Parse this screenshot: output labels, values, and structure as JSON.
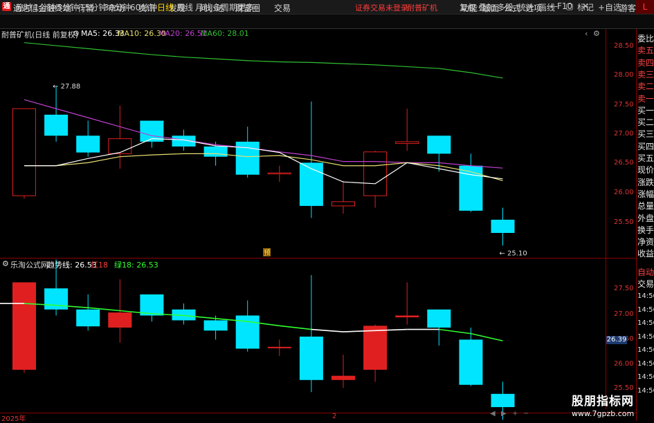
{
  "titlebar": {
    "app_title": "通达信金融终端",
    "menus": [
      "行情",
      "市场",
      "资讯",
      "发现",
      "问小达",
      "财富圈",
      "交易"
    ],
    "notice": "证券交易未登录",
    "stock_name": "耐普矿机",
    "right_menus": [
      "功能",
      "版面",
      "公式",
      "选项"
    ],
    "guest": "游客"
  },
  "toolbar": {
    "periods": [
      "分时",
      "1分钟",
      "5分钟",
      "15分钟",
      "30分钟",
      "60分钟",
      "日线",
      "周线",
      "月线",
      "多周期",
      "更多"
    ],
    "active": "日线",
    "right_tools": [
      "复权",
      "叠加",
      "多股",
      "统计",
      "画线",
      "F10",
      "标记",
      "+自选"
    ],
    "right_tab": "L"
  },
  "main_info": {
    "title": "耐普矿机(日线 前复权)",
    "ma5": "MA5: 26.33",
    "ma10": "MA10: 26.30",
    "ma20": "MA20: 26.51",
    "ma60": "MA60: 28.01",
    "high_mark": "27.88",
    "low_mark": "25.10",
    "flag": "预"
  },
  "sub_info": {
    "title": "乐淘公式网",
    "trend": "趋势线: 26.53",
    "red": "红18",
    "green": "绿18: 26.53",
    "cross_value": "26.39"
  },
  "axis_main": [
    "28.50",
    "28.00",
    "27.50",
    "27.00",
    "26.50",
    "26.00",
    "25.50"
  ],
  "axis_sub": [
    "27.50",
    "27.00",
    "26.50",
    "26.00",
    "25.50"
  ],
  "time_axis": {
    "start": "2025年",
    "mid": "2"
  },
  "right_panel": {
    "labels": [
      "委比",
      "卖五",
      "卖四",
      "卖三",
      "卖二",
      "卖一",
      "买一",
      "买二",
      "买三",
      "买四",
      "买五",
      "现价",
      "涨跌",
      "涨幅",
      "总量",
      "外盘",
      "换手",
      "净资",
      "收益"
    ],
    "mode1": "自动",
    "mode2": "交易",
    "times": [
      "14:56",
      "14:56",
      "14:56",
      "14:56",
      "14:56",
      "14:56",
      "14:56",
      "14:56"
    ]
  },
  "watermark": {
    "line1": "股朋指标网",
    "line2": "www.7gpzb.com"
  },
  "colors": {
    "up": "#e02020",
    "down": "#00e5ff",
    "ma5": "#ffffff",
    "ma10": "#e8e070",
    "ma20": "#c040d0",
    "ma60": "#30c030",
    "trend": "#30ff30"
  },
  "chart_data": [
    {
      "type": "candlestick",
      "title": "耐普矿机(日线 前复权)",
      "ylim": [
        25.05,
        28.85
      ],
      "ohlc": [
        {
          "o": 26.05,
          "h": 27.0,
          "l": 26.0,
          "c": 27.5
        },
        {
          "o": 27.4,
          "h": 27.88,
          "l": 26.95,
          "c": 27.05
        },
        {
          "o": 27.05,
          "h": 27.3,
          "l": 26.7,
          "c": 26.77
        },
        {
          "o": 26.75,
          "h": 27.55,
          "l": 26.5,
          "c": 27.0
        },
        {
          "o": 27.3,
          "h": 27.3,
          "l": 26.85,
          "c": 26.95
        },
        {
          "o": 27.05,
          "h": 27.15,
          "l": 26.8,
          "c": 26.87
        },
        {
          "o": 26.87,
          "h": 26.95,
          "l": 26.55,
          "c": 26.7
        },
        {
          "o": 26.95,
          "h": 27.2,
          "l": 26.35,
          "c": 26.4
        },
        {
          "o": 26.43,
          "h": 26.55,
          "l": 26.28,
          "c": 26.43
        },
        {
          "o": 26.6,
          "h": 27.62,
          "l": 25.68,
          "c": 25.88
        },
        {
          "o": 25.88,
          "h": 26.3,
          "l": 25.75,
          "c": 25.95
        },
        {
          "o": 26.05,
          "h": 26.8,
          "l": 25.85,
          "c": 26.78
        },
        {
          "o": 26.92,
          "h": 27.5,
          "l": 26.8,
          "c": 26.95
        },
        {
          "o": 27.05,
          "h": 27.05,
          "l": 26.45,
          "c": 26.75
        },
        {
          "o": 26.55,
          "h": 26.75,
          "l": 25.78,
          "c": 25.8
        },
        {
          "o": 25.65,
          "h": 25.85,
          "l": 25.22,
          "c": 25.43
        }
      ],
      "ma5": [
        26.55,
        26.55,
        26.67,
        26.77,
        27.0,
        26.98,
        26.88,
        26.85,
        26.77,
        26.5,
        26.28,
        26.25,
        26.6,
        26.5,
        26.4,
        26.33
      ],
      "ma10": [
        26.55,
        26.55,
        26.6,
        26.7,
        26.73,
        26.75,
        26.75,
        26.7,
        26.72,
        26.65,
        26.55,
        26.55,
        26.6,
        26.55,
        26.45,
        26.3
      ],
      "ma20": [
        27.65,
        27.5,
        27.35,
        27.2,
        27.05,
        26.98,
        26.9,
        26.85,
        26.78,
        26.72,
        26.62,
        26.62,
        26.6,
        26.6,
        26.55,
        26.51
      ],
      "ma60": [
        28.6,
        28.55,
        28.5,
        28.45,
        28.4,
        28.36,
        28.33,
        28.3,
        28.28,
        28.27,
        28.25,
        28.23,
        28.2,
        28.17,
        28.1,
        28.01
      ]
    },
    {
      "type": "candlestick",
      "title": "乐淘公式网",
      "ylim": [
        25.35,
        27.85
      ],
      "trend": [
        27.15,
        27.12,
        27.08,
        27.03,
        26.98,
        26.95,
        26.9,
        26.85,
        26.78,
        26.72,
        26.68,
        26.7,
        26.72,
        26.72,
        26.65,
        26.53
      ],
      "trend_color_index": [
        "w",
        "g",
        "g",
        "g",
        "g",
        "g",
        "g",
        "g",
        "g",
        "g",
        "w",
        "w",
        "w",
        "w",
        "g",
        "g"
      ]
    }
  ]
}
